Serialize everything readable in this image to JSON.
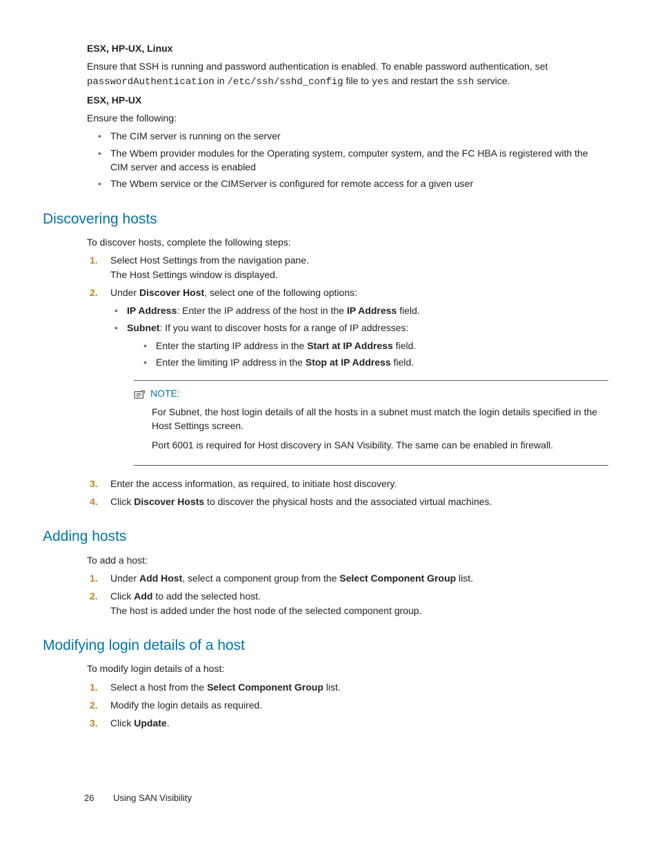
{
  "sec1": {
    "h1": "ESX, HP-UX, Linux",
    "p1a": "Ensure that SSH is running and password authentication is enabled. To enable password authentication, set ",
    "c1": "passwordAuthentication",
    "p1b": " in ",
    "c2": "/etc/ssh/sshd_config",
    "p1c": " file to ",
    "c3": "yes",
    "p1d": " and restart the ",
    "c4": "ssh",
    "p1e": " service.",
    "h2": "ESX, HP-UX",
    "p2": "Ensure the following:",
    "b1": "The CIM server is running on the server",
    "b2": "The Wbem provider modules for the Operating system, computer system, and the FC HBA is registered with the CIM server and access is enabled",
    "b3": "The Wbem service or the CIMServer is configured for remote access for a given user"
  },
  "disc": {
    "title": "Discovering hosts",
    "intro": "To discover hosts, complete the following steps:",
    "s1a": "Select Host Settings from the navigation pane.",
    "s1b": "The Host Settings window is displayed.",
    "s2pre": "Under ",
    "s2bold": "Discover Host",
    "s2post": ", select one of the following options:",
    "ip_b": "IP Address",
    "ip_t": ": Enter the IP address of the host in the ",
    "ip_b2": "IP Address",
    "ip_t2": " field.",
    "sn_b": "Subnet",
    "sn_t": ": If you want to discover hosts for a range of IP addresses:",
    "sn1a": "Enter the starting IP address in the ",
    "sn1b": "Start at IP Address",
    "sn1c": " field.",
    "sn2a": "Enter the limiting IP address in the ",
    "sn2b": "Stop at IP Address",
    "sn2c": " field.",
    "note_label": "NOTE:",
    "note1": "For Subnet, the host login details of all the hosts in a subnet must match the login details specified in the Host Settings screen.",
    "note2": "Port 6001 is required for Host discovery in SAN Visibility. The same can be enabled in firewall.",
    "s3": "Enter the access information, as required, to initiate host discovery.",
    "s4a": "Click ",
    "s4b": "Discover Hosts",
    "s4c": " to discover the physical hosts and the associated virtual machines."
  },
  "add": {
    "title": "Adding hosts",
    "intro": "To add a host:",
    "s1a": "Under ",
    "s1b": "Add Host",
    "s1c": ", select a component group from the ",
    "s1d": "Select Component Group",
    "s1e": " list.",
    "s2a": "Click ",
    "s2b": "Add",
    "s2c": " to add the selected host.",
    "s2d": "The host is added under the host node of the selected component group."
  },
  "mod": {
    "title": "Modifying login details of a host",
    "intro": "To modify login details of a host:",
    "s1a": "Select a host from the ",
    "s1b": "Select Component Group",
    "s1c": " list.",
    "s2": "Modify the login details as required.",
    "s3a": "Click ",
    "s3b": "Update",
    "s3c": "."
  },
  "footer": {
    "page": "26",
    "title": "Using SAN Visibility"
  }
}
